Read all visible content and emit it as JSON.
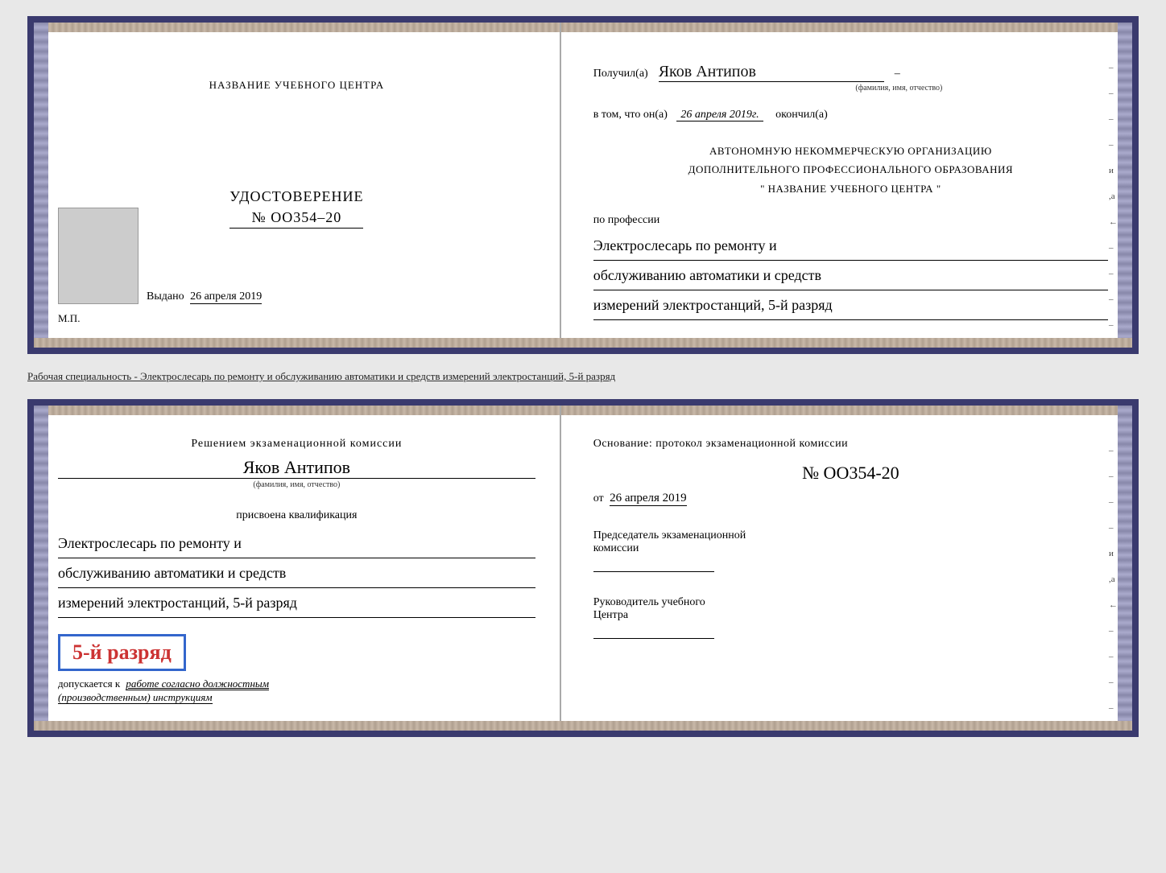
{
  "top_doc": {
    "left": {
      "school_name": "НАЗВАНИЕ УЧЕБНОГО ЦЕНТРА",
      "udostoverenie_label": "УДОСТОВЕРЕНИЕ",
      "number": "№ ОО354–20",
      "photo_alt": "Фото",
      "vydano_prefix": "Выдано",
      "vydano_date": "26 апреля 2019",
      "mp_label": "М.П."
    },
    "right": {
      "poluchil_prefix": "Получил(а)",
      "fio_value": "Яков Антипов",
      "fio_hint": "(фамилия, имя, отчество)",
      "vtom_prefix": "в том, что он(а)",
      "date_italic": "26 апреля 2019г.",
      "okonchil": "окончил(а)",
      "avto_line1": "АВТОНОМНУЮ НЕКОММЕРЧЕСКУЮ ОРГАНИЗАЦИЮ",
      "avto_line2": "ДОПОЛНИТЕЛЬНОГО ПРОФЕССИОНАЛЬНОГО ОБРАЗОВАНИЯ",
      "avto_line3": "\"  НАЗВАНИЕ УЧЕБНОГО ЦЕНТРА  \"",
      "po_professii": "по профессии",
      "prof_line1": "Электрослесарь по ремонту и",
      "prof_line2": "обслуживанию автоматики и средств",
      "prof_line3": "измерений электростанций, 5-й разряд",
      "side_marks": [
        "–",
        "–",
        "–",
        "–",
        "и",
        ",а",
        "←",
        "–",
        "–",
        "–",
        "–"
      ]
    }
  },
  "between_text": "Рабочая специальность - Электрослесарь по ремонту и обслуживанию автоматики и средств измерений электростанций, 5-й разряд",
  "bottom_doc": {
    "left": {
      "resheniem_text": "Решением экзаменационной комиссии",
      "fio_value": "Яков Антипов",
      "fio_hint": "(фамилия, имя, отчество)",
      "prisvoena_text": "присвоена квалификация",
      "qual_line1": "Электрослесарь по ремонту и",
      "qual_line2": "обслуживанию автоматики и средств",
      "qual_line3": "измерений электростанций, 5-й разряд",
      "rank_text": "5-й разряд",
      "dopuskaetsya_prefix": "допускается к",
      "dopuskaetsya_italic1": "работе согласно должностным",
      "dopuskaetsya_italic2": "(производственным) инструкциям"
    },
    "right": {
      "osnovanie_text": "Основание: протокол экзаменационной комиссии",
      "protocol_number": "№ ОО354-20",
      "ot_prefix": "от",
      "ot_date": "26 апреля 2019",
      "predsedatel_line1": "Председатель экзаменационной",
      "predsedatel_line2": "комиссии",
      "rukovoditel_line1": "Руководитель учебного",
      "rukovoditel_line2": "Центра",
      "side_marks": [
        "–",
        "–",
        "–",
        "–",
        "и",
        ",а",
        "←",
        "–",
        "–",
        "–",
        "–"
      ]
    }
  }
}
